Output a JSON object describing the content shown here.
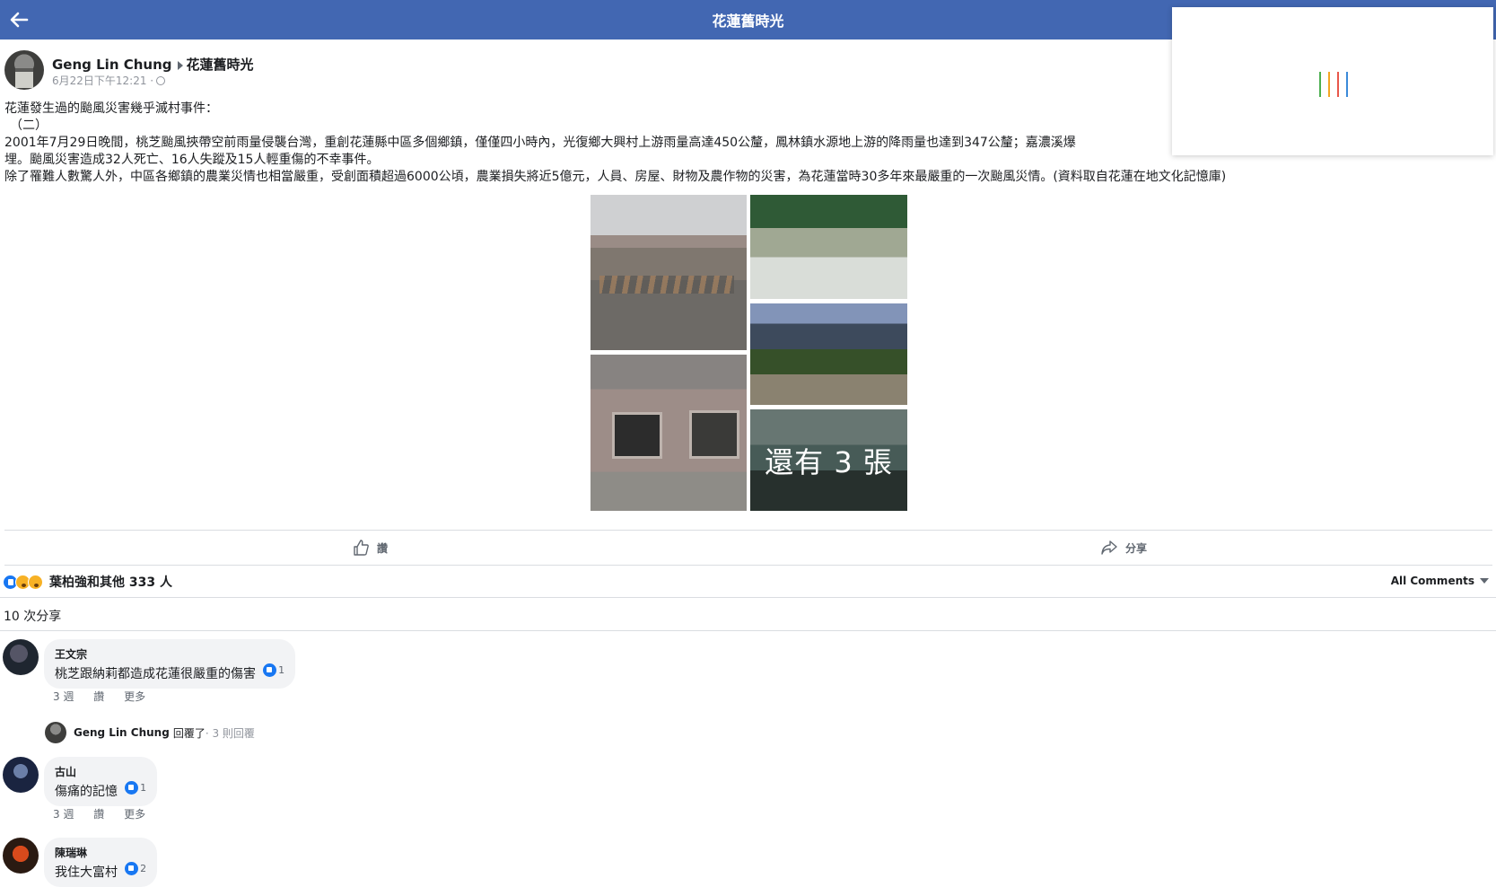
{
  "topbar": {
    "title": "花蓮舊時光"
  },
  "post": {
    "author": "Geng Lin Chung",
    "group": "花蓮舊時光",
    "time": "6月22日下午12:21 ·",
    "text_lines": [
      "花蓮發生過的颱風災害幾乎滅村事件：",
      "（二）",
      "2001年7月29日晚間，桃芝颱風挾帶空前雨量侵襲台灣，重創花蓮縣中區多個鄉鎮，僅僅四小時內，光復鄉大興村上游雨量高達450公釐，鳳林鎮水源地上游的降雨量也達到347公釐；嘉濃溪爆",
      "埋。颱風災害造成32人死亡、16人失蹤及15人輕重傷的不幸事件。",
      "除了罹難人數驚人外，中區各鄉鎮的農業災情也相當嚴重，受創面積超過6000公頃，農業損失將近5億元，人員、房屋、財物及農作物的災害，為花蓮當時30多年來最嚴重的一次颱風災情。(資料取自花蓮在地文化記憶庫)"
    ],
    "more_photos_label": "還有 3 張"
  },
  "actions": {
    "like_label": "讚",
    "share_label": "分享"
  },
  "summary": {
    "reactions_text": "葉柏強和其他 333 人",
    "sort_label": "All Comments",
    "shares_text": "10 次分享"
  },
  "comments": [
    {
      "name": "王文宗",
      "text": "桃芝跟納莉都造成花蓮很嚴重的傷害",
      "likes": "1",
      "time": "3 週",
      "like_label": "讚",
      "more_label": "更多"
    },
    {
      "name": "古山",
      "text": "傷痛的記憶",
      "likes": "1",
      "time": "3 週",
      "like_label": "讚",
      "more_label": "更多"
    },
    {
      "name": "陳瑞琳",
      "text": "我住大富村",
      "likes": "2"
    }
  ],
  "reply_summary": {
    "name": "Geng Lin Chung",
    "verb": "回覆了",
    "count": "· 3 則回覆"
  },
  "colors": {
    "topbar": "#4267b2",
    "like_blue": "#1877f2"
  }
}
